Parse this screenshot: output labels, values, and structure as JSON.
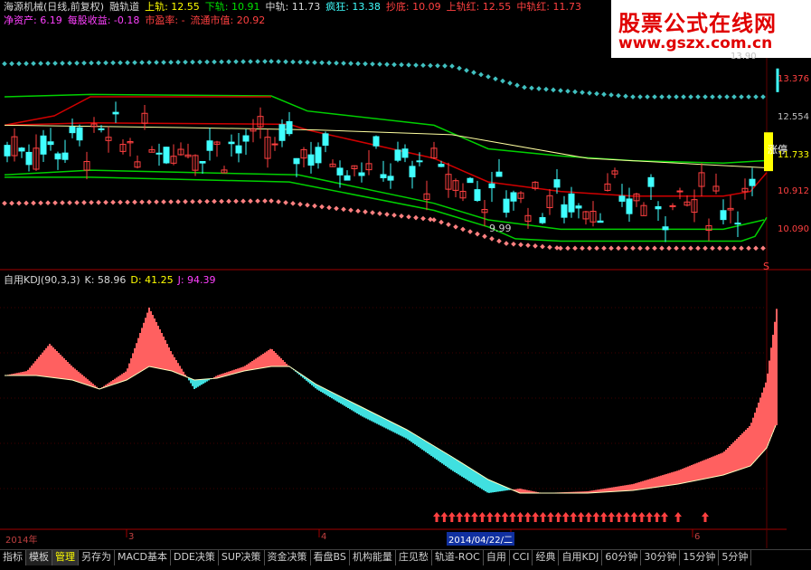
{
  "header": {
    "line1": [
      {
        "text": "海源机械(日线,前复权)",
        "color": "#d8d8d8"
      },
      {
        "text": "融轨道",
        "color": "#d8d8d8"
      },
      {
        "text": "上轨: 12.55",
        "color": "#ffff00"
      },
      {
        "text": "下轨: 10.91",
        "color": "#00e000"
      },
      {
        "text": "中轨: 11.73",
        "color": "#d8d8d8"
      },
      {
        "text": "疯狂: 13.38",
        "color": "#40ffff"
      },
      {
        "text": "抄底: 10.09",
        "color": "#ff4040"
      },
      {
        "text": "上轨红: 12.55",
        "color": "#ff4040"
      },
      {
        "text": "中轨红: 11.73",
        "color": "#ff4040"
      }
    ],
    "line2": [
      {
        "text": "净资产: 6.19",
        "color": "#ff40ff"
      },
      {
        "text": "每股收益: -0.18",
        "color": "#ff40ff"
      },
      {
        "text": "市盈率: -",
        "color": "#ff4040"
      },
      {
        "text": "流通市值: 20.92",
        "color": "#ff4040"
      }
    ]
  },
  "watermark": {
    "line1": "股票公式在线网",
    "line2": "www.gszx.com.cn",
    "color": "#e00000"
  },
  "price_axis_labels": [
    {
      "text": "13.90",
      "color": "#c0c0c0"
    },
    {
      "text": "13.376",
      "color": "#ff4040"
    },
    {
      "text": "12.554",
      "color": "#c0c0c0"
    },
    {
      "text": "11.733",
      "color": "#ffff00"
    },
    {
      "text": "10.912",
      "color": "#ff4040"
    },
    {
      "text": "10.090",
      "color": "#ff4040"
    }
  ],
  "annotations": {
    "low_price": "9.99",
    "limit_up": "涨停",
    "s_marker": "S"
  },
  "kdj_header": [
    {
      "text": "自用KDJ(90,3,3)",
      "color": "#d8d8d8"
    },
    {
      "text": "K: 58.96",
      "color": "#d8d8d8"
    },
    {
      "text": "D: 41.25",
      "color": "#ffff00"
    },
    {
      "text": "J: 94.39",
      "color": "#ff40ff"
    }
  ],
  "time_axis": {
    "labels": [
      "2014年",
      "3",
      "4",
      "2014/04/22/二",
      "6"
    ],
    "color": "#c04040"
  },
  "chart_data": [
    {
      "type": "candlestick",
      "title": "海源机械(日线,前复权)",
      "ylim": [
        9.8,
        14.2
      ],
      "indicator": "融轨道",
      "values": {
        "上轨": 12.55,
        "下轨": 10.91,
        "中轨": 11.73,
        "疯狂": 13.38,
        "抄底": 10.09
      },
      "low_annotation": 9.99,
      "close_last": 12.55,
      "colors": {
        "up": "#ff4040",
        "down": "#40ffff",
        "upper_band": "#00e000",
        "red_band": "#e00000",
        "yellow_line": "#ffffa0",
        "magenta_line": "#ff40ff",
        "crazy_dots": "#40c0c0",
        "bottom_dots": "#ff8080"
      }
    },
    {
      "type": "area",
      "title": "自用KDJ(90,3,3)",
      "values": {
        "K": 58.96,
        "D": 41.25,
        "J": 94.39
      },
      "colors": {
        "bull_fill": "#ff6060",
        "bear_fill": "#40e0e0",
        "D_line": "#ffffc0",
        "arrow": "#ff4040"
      }
    }
  ],
  "tabs": {
    "items": [
      "指标",
      "模板",
      "管理",
      "另存为",
      "MACD基本",
      "DDE决策",
      "SUP决策",
      "资金决策",
      "看盘BS",
      "机构能量",
      "庄见愁",
      "轨道-ROC",
      "自用",
      "CCI",
      "经典",
      "自用KDJ",
      "60分钟",
      "30分钟",
      "15分钟",
      "5分钟"
    ],
    "active_index": 2,
    "selected_index": 1
  },
  "status_bar": "...........................................",
  "status_text": ""
}
